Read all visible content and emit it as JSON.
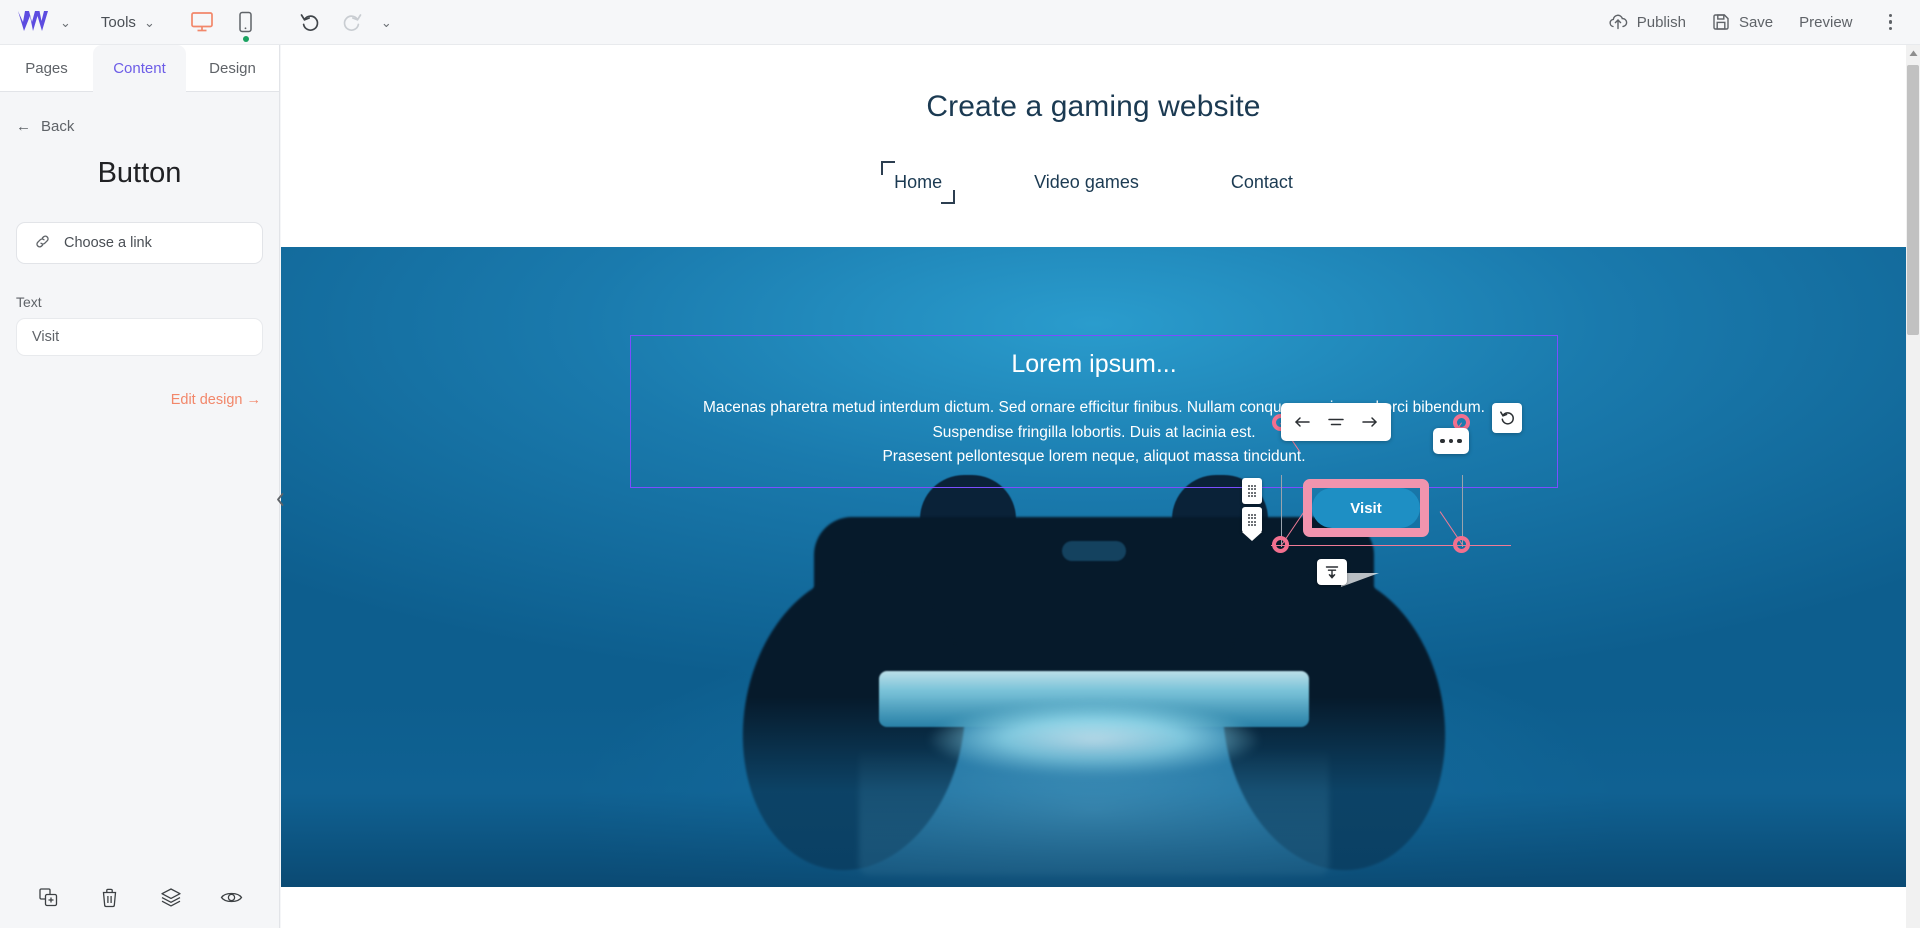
{
  "topbar": {
    "logo_name": "webflow-logo",
    "logo_chevron": "⌄",
    "tools_label": "Tools",
    "tools_chevron": "⌄",
    "devices": [
      {
        "name": "desktop-view",
        "active": true
      },
      {
        "name": "mobile-view",
        "active": false,
        "status_dot": "#1aa260"
      }
    ],
    "undo_label": "undo",
    "redo_label": "redo",
    "history_chevron": "⌄",
    "publish_label": "Publish",
    "save_label": "Save",
    "preview_label": "Preview",
    "accent_color": "#f2876a"
  },
  "sidebar": {
    "tabs": [
      {
        "label": "Pages",
        "active": false
      },
      {
        "label": "Content",
        "active": true
      },
      {
        "label": "Design",
        "active": false
      }
    ],
    "active_tab_color": "#6c5ce7",
    "back_label": "Back",
    "back_arrow": "←",
    "panel_title": "Button",
    "choose_link_label": "Choose a link",
    "text_field": {
      "label": "Text",
      "value": "Visit",
      "placeholder": "Visit"
    },
    "edit_design_label": "Edit design",
    "edit_design_arrow": "→",
    "edit_design_color": "#f2876a",
    "bottom_tools": [
      {
        "name": "duplicate-icon"
      },
      {
        "name": "delete-icon"
      },
      {
        "name": "layers-icon"
      },
      {
        "name": "visibility-icon"
      }
    ],
    "collapse_label": "‹"
  },
  "canvas": {
    "site_title": "Create a gaming website",
    "nav": [
      {
        "label": "Home",
        "selected": true
      },
      {
        "label": "Video games",
        "selected": false
      },
      {
        "label": "Contact",
        "selected": false
      }
    ],
    "hero": {
      "heading": "Lorem ipsum...",
      "paragraph_lines": [
        "Macenas pharetra metud interdum dictum. Sed ornare efficitur finibus. Nullam conque maurius sed orci bibendum.",
        "Suspendise fringilla lobortis. Duis at lacinia est.",
        "Prasesent pellontesque lorem neque, aliquot massa tincidunt."
      ],
      "button_label": "Visit",
      "button_color": "#1e8fc4",
      "selection_color": "#f194ae",
      "textblock_outline_color": "#7c4dff"
    },
    "float_toolbar": [
      {
        "name": "align-left-icon"
      },
      {
        "name": "align-center-icon"
      },
      {
        "name": "align-right-icon"
      }
    ],
    "rotate_icon": "rotate-icon",
    "more_options": "more-options-icon",
    "insert_badge": "insert-below-icon"
  },
  "scrollbar": {
    "up_arrow": "▲"
  }
}
